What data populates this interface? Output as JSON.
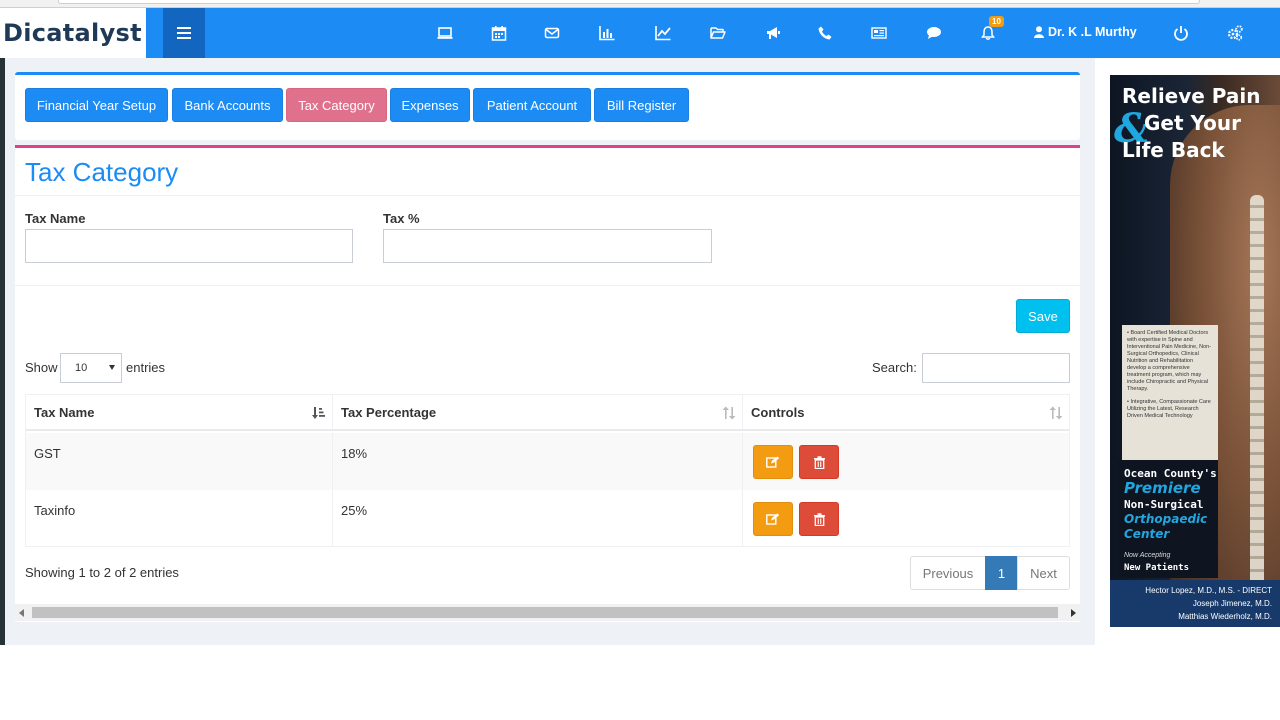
{
  "brand": {
    "logo_text": "Dicatalyst"
  },
  "topnav": {
    "notification_count": "10",
    "user_name": "Dr. K .L Murthy",
    "icons": [
      "desktop-icon",
      "calendar-icon",
      "mail-icon",
      "bar-chart-icon",
      "line-chart-icon",
      "folder-open-icon",
      "bullhorn-icon",
      "phone-icon",
      "newspaper-icon",
      "chat-icon",
      "bell-icon",
      "user-icon",
      "power-icon",
      "settings-icon"
    ]
  },
  "tabs": [
    {
      "label": "Financial Year Setup",
      "active": false
    },
    {
      "label": "Bank Accounts",
      "active": false
    },
    {
      "label": "Tax Category",
      "active": true
    },
    {
      "label": "Expenses",
      "active": false
    },
    {
      "label": "Patient Account",
      "active": false
    },
    {
      "label": "Bill Register",
      "active": false
    }
  ],
  "page": {
    "title": "Tax Category",
    "form": {
      "tax_name_label": "Tax Name",
      "tax_name_value": "",
      "tax_percent_label": "Tax %",
      "tax_percent_value": ""
    },
    "save_label": "Save",
    "show_label": "Show",
    "entries_value": "10",
    "entries_label": "entries",
    "search_label": "Search:",
    "search_value": ""
  },
  "table": {
    "columns": [
      "Tax Name",
      "Tax Percentage",
      "Controls"
    ],
    "rows": [
      {
        "tax_name": "GST",
        "tax_percentage": "18%"
      },
      {
        "tax_name": "Taxinfo",
        "tax_percentage": "25%"
      }
    ],
    "info": "Showing 1 to 2 of 2 entries",
    "pagination": {
      "previous": "Previous",
      "current": "1",
      "next": "Next"
    }
  },
  "ad": {
    "headline_1": "Relieve Pain",
    "headline_amp": "&",
    "headline_2": "Get Your",
    "headline_3": "Life Back",
    "bullet_1": "• Board Certified Medical Doctors with expertise in Spine and Interventional Pain Medicine, Non-Surgical Orthopedics, Clinical Nutrition and Rehabilitation develop a comprehensive treatment program, which may include Chiropractic and Physical Therapy.",
    "bullet_2": "• Integrative, Compassionate Care Utilizing the Latest, Research Driven Medical Technology",
    "line_1": "Ocean County's",
    "line_2": "Premiere",
    "line_3": "Non-Surgical",
    "line_4": "Orthopaedic",
    "line_5": "Center",
    "accepting": "Now Accepting",
    "new_patients": "New Patients",
    "doctor_1": "Hector Lopez, M.D., M.S. - DIRECT",
    "doctor_2": "Joseph Jimenez, M.D.",
    "doctor_3": "Matthias Wiederholz, M.D."
  },
  "colors": {
    "primary": "#1c8bf4",
    "active_tab": "#e0718d",
    "box_accent": "#e33e8b",
    "save": "#00c0ef",
    "edit": "#f39c12",
    "delete": "#dd4b39",
    "pager_active": "#337ab7"
  }
}
